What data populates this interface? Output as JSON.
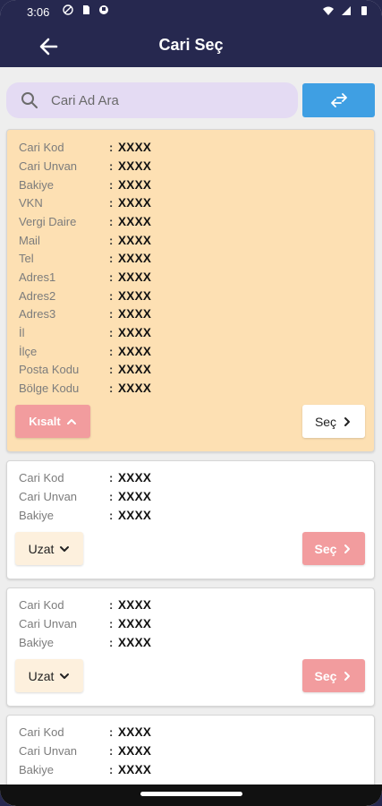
{
  "status_bar": {
    "time": "3:06"
  },
  "app_bar": {
    "title": "Cari Seç"
  },
  "search": {
    "placeholder": "Cari Ad Ara"
  },
  "cards": [
    {
      "fields": [
        {
          "label": "Cari Kod",
          "value": "XXXX"
        },
        {
          "label": "Cari Unvan",
          "value": "XXXX"
        },
        {
          "label": "Bakiye",
          "value": "XXXX"
        },
        {
          "label": "VKN",
          "value": "XXXX"
        },
        {
          "label": "Vergi Daire",
          "value": "XXXX"
        },
        {
          "label": "Mail",
          "value": "XXXX"
        },
        {
          "label": "Tel",
          "value": "XXXX"
        },
        {
          "label": "Adres1",
          "value": "XXXX"
        },
        {
          "label": "Adres2",
          "value": "XXXX"
        },
        {
          "label": "Adres3",
          "value": "XXXX"
        },
        {
          "label": "İl",
          "value": "XXXX"
        },
        {
          "label": "İlçe",
          "value": "XXXX"
        },
        {
          "label": "Posta Kodu",
          "value": "XXXX"
        },
        {
          "label": "Bölge Kodu",
          "value": "XXXX"
        }
      ],
      "toggle_label": "Kısalt",
      "select_label": "Seç"
    },
    {
      "fields": [
        {
          "label": "Cari Kod",
          "value": "XXXX"
        },
        {
          "label": "Cari Unvan",
          "value": "XXXX"
        },
        {
          "label": "Bakiye",
          "value": "XXXX"
        }
      ],
      "toggle_label": "Uzat",
      "select_label": "Seç"
    },
    {
      "fields": [
        {
          "label": "Cari Kod",
          "value": "XXXX"
        },
        {
          "label": "Cari Unvan",
          "value": "XXXX"
        },
        {
          "label": "Bakiye",
          "value": "XXXX"
        }
      ],
      "toggle_label": "Uzat",
      "select_label": "Seç"
    },
    {
      "fields": [
        {
          "label": "Cari Kod",
          "value": "XXXX"
        },
        {
          "label": "Cari Unvan",
          "value": "XXXX"
        },
        {
          "label": "Bakiye",
          "value": "XXXX"
        }
      ]
    }
  ],
  "colors": {
    "app_bar": "#26284f",
    "expanded_card": "#fde0b3",
    "search_bg": "#e4dbf3",
    "swap_button": "#3f9fe3",
    "pink_button": "#f29c9e"
  }
}
